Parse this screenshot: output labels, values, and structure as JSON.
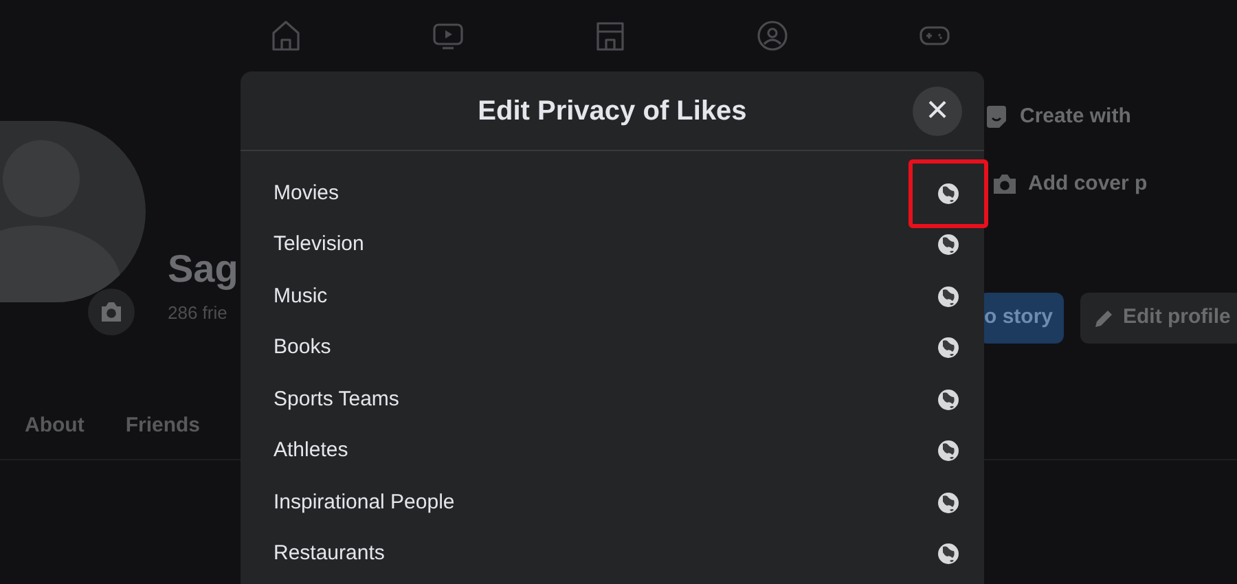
{
  "top_nav": [
    {
      "kind": "home"
    },
    {
      "kind": "video"
    },
    {
      "kind": "store"
    },
    {
      "kind": "groups"
    },
    {
      "kind": "gaming"
    }
  ],
  "profile": {
    "name": "Sag",
    "friends": "286 frie",
    "buttons": [
      {
        "kind": "create",
        "label": "Create with"
      },
      {
        "kind": "cover",
        "label": "Add cover p"
      }
    ],
    "actions": [
      {
        "kind": "primary",
        "label": "o story"
      },
      {
        "kind": "edit",
        "label": "Edit profile"
      }
    ],
    "tabs": [
      "About",
      "Friends"
    ]
  },
  "dialog": {
    "title": "Edit Privacy of Likes",
    "close": "×",
    "items": [
      {
        "label": "Movies",
        "highlighted": true
      },
      {
        "label": "Television",
        "highlighted": false
      },
      {
        "label": "Music",
        "highlighted": false
      },
      {
        "label": "Books",
        "highlighted": false
      },
      {
        "label": "Sports Teams",
        "highlighted": false
      },
      {
        "label": "Athletes",
        "highlighted": false
      },
      {
        "label": "Inspirational People",
        "highlighted": false
      },
      {
        "label": "Restaurants",
        "highlighted": false
      }
    ]
  }
}
